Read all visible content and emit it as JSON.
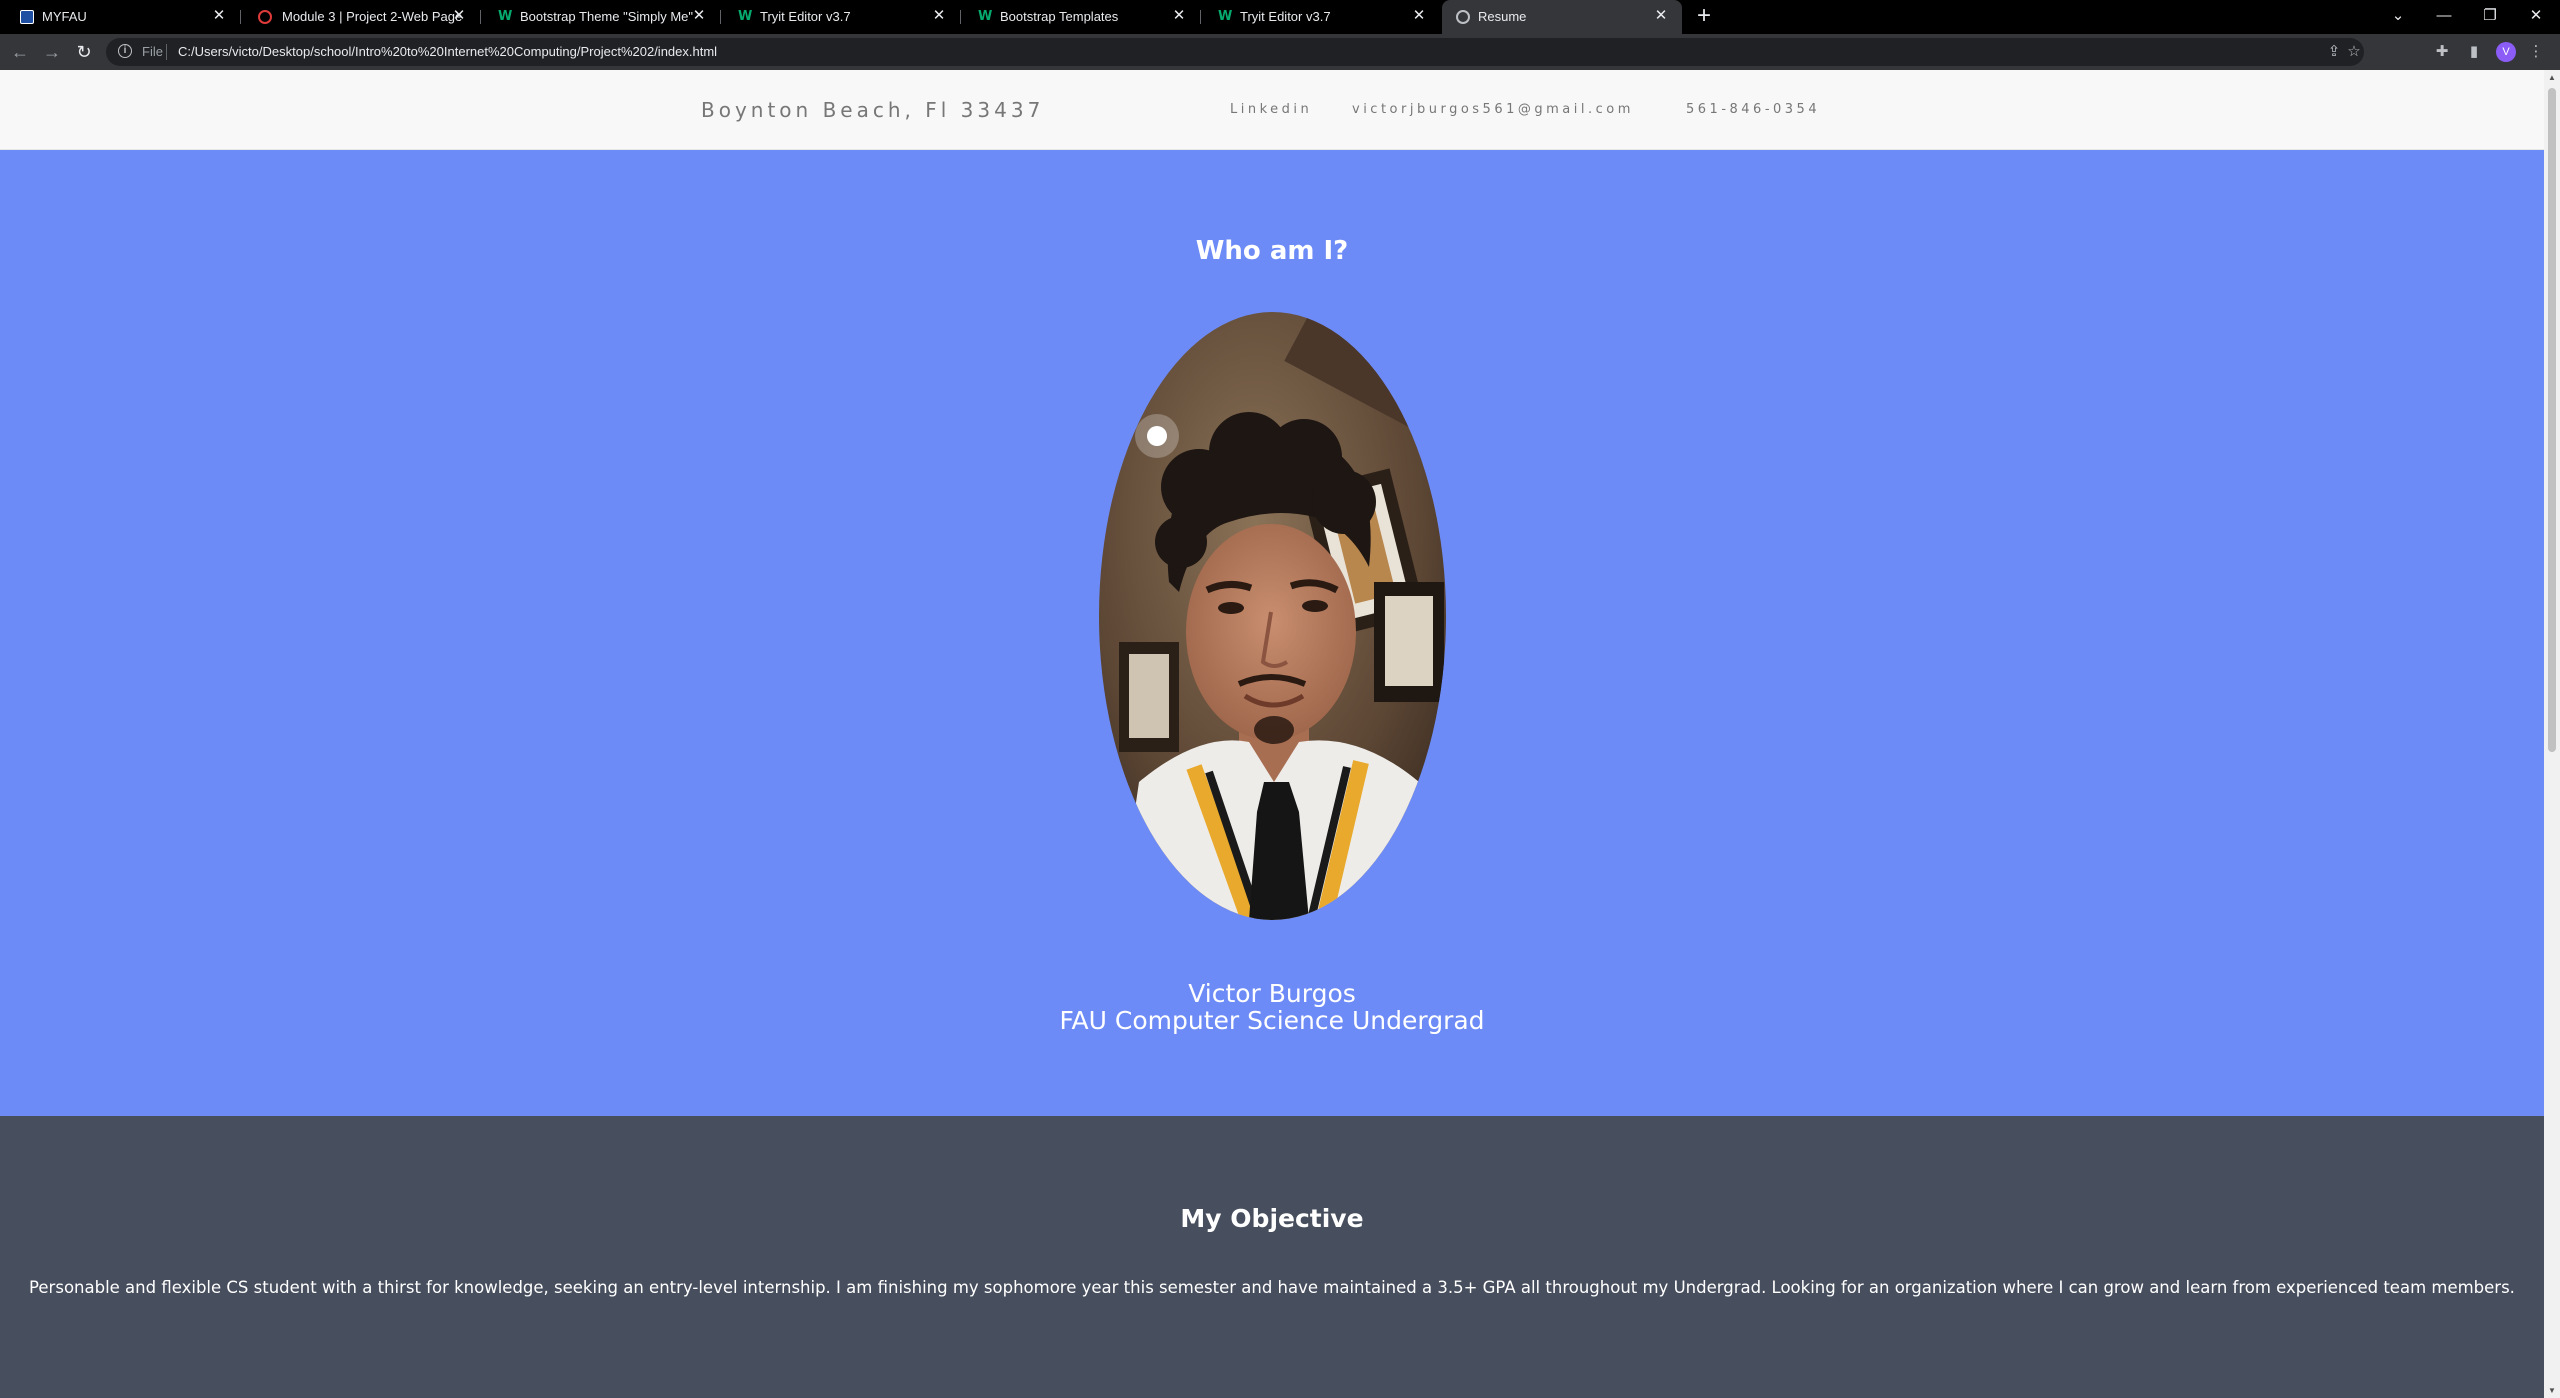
{
  "browser": {
    "tabs": [
      {
        "title": "MYFAU",
        "favicon": "myfau-icon"
      },
      {
        "title": "Module 3 | Project 2-Web Page",
        "favicon": "canvas-icon"
      },
      {
        "title": "Bootstrap Theme \"Simply Me\"",
        "favicon": "w3schools-icon"
      },
      {
        "title": "Tryit Editor v3.7",
        "favicon": "w3schools-icon"
      },
      {
        "title": "Bootstrap Templates",
        "favicon": "w3schools-icon"
      },
      {
        "title": "Tryit Editor v3.7",
        "favicon": "w3schools-icon"
      },
      {
        "title": "Resume",
        "favicon": "globe-icon",
        "active": true
      }
    ],
    "address_bar": {
      "scheme_label": "File",
      "url": "C:/Users/victo/Desktop/school/Intro%20to%20Internet%20Computing/Project%202/index.html"
    },
    "profile_initial": "V"
  },
  "site": {
    "brand": "Boynton Beach, Fl 33437",
    "nav": [
      {
        "label": "Linkedin"
      },
      {
        "label": "victorjburgos561@gmail.com"
      },
      {
        "label": "561-846-0354"
      }
    ]
  },
  "hero": {
    "heading": "Who am I?",
    "name": "Victor Burgos",
    "subtitle": "FAU Computer Science Undergrad",
    "background_color": "#6d8bf7"
  },
  "objective": {
    "heading": "My Objective",
    "text": "Personable and flexible CS student with a thirst for knowledge, seeking an entry-level internship. I am finishing my sophomore year this semester and have maintained a 3.5+ GPA all throughout my Undergrad. Looking for an organization where I can grow and learn from experienced team members.",
    "background_color": "#474e5d"
  }
}
